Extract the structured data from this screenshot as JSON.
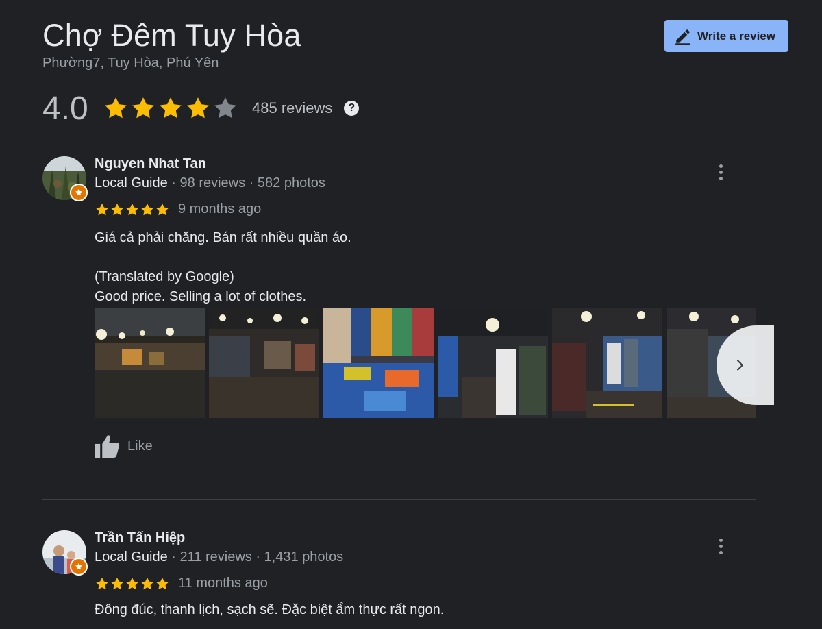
{
  "place": {
    "title": "Chợ Đêm Tuy Hòa",
    "address": "Phường7, Tuy Hòa, Phú Yên"
  },
  "write_review": {
    "label": "Write a review",
    "icon": "pencil-icon"
  },
  "summary": {
    "rating": "4.0",
    "stars": 4,
    "review_count": "485 reviews",
    "help_icon": "?"
  },
  "colors": {
    "star_filled": "#fbbc04",
    "star_empty": "#80868b",
    "accent_button": "#8ab4f8",
    "background": "#202124"
  },
  "reviews": [
    {
      "name": "Nguyen Nhat Tan",
      "guide": "Local Guide",
      "stats": " · 98 reviews · 582 photos",
      "stars": 5,
      "time": "9 months ago",
      "text_original": "Giá cả phải chăng. Bán rất nhiều quần áo.",
      "translated_label": "(Translated by Google)",
      "text_translated": "Good price. Selling a lot of clothes.",
      "photo_count_visible": 6,
      "like_label": "Like"
    },
    {
      "name": "Trần Tấn Hiệp",
      "guide": "Local Guide",
      "stats": " · 211 reviews · 1,431 photos",
      "stars": 5,
      "time": "11 months ago",
      "text_original": "Đông đúc, thanh lịch, sạch sẽ. Đặc biệt ẩm thực rất ngon."
    }
  ]
}
